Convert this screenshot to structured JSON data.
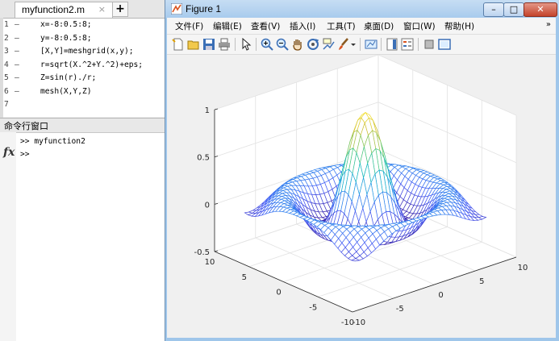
{
  "editor": {
    "tab_label": "myfunction2.m",
    "tab_close": "×",
    "new_tab": "+",
    "lines": [
      {
        "num": "1",
        "marker": "–",
        "code": "x=-8:0.5:8;"
      },
      {
        "num": "2",
        "marker": "–",
        "code": "y=-8:0.5:8;"
      },
      {
        "num": "3",
        "marker": "–",
        "code": "[X,Y]=meshgrid(x,y);"
      },
      {
        "num": "4",
        "marker": "–",
        "code": "r=sqrt(X.^2+Y.^2)+eps;"
      },
      {
        "num": "5",
        "marker": "–",
        "code": "Z=sin(r)./r;"
      },
      {
        "num": "6",
        "marker": "–",
        "code": "mesh(X,Y,Z)"
      },
      {
        "num": "7",
        "marker": "",
        "code": ""
      }
    ]
  },
  "command_window": {
    "title": "命令行窗口",
    "history": [
      ">> myfunction2",
      ">>"
    ],
    "fx": "fx"
  },
  "figure": {
    "title": "Figure 1",
    "menus": [
      "文件(F)",
      "编辑(E)",
      "查看(V)",
      "插入(I)",
      "工具(T)",
      "桌面(D)",
      "窗口(W)",
      "帮助(H)"
    ],
    "menu_overflow": "»",
    "window_buttons": {
      "minimize": "–",
      "maximize": "□",
      "close": "✕"
    },
    "toolbar_icons": [
      "new-figure-icon",
      "open-file-icon",
      "save-icon",
      "print-icon",
      "select-arrow-icon",
      "zoom-in-icon",
      "zoom-out-icon",
      "pan-hand-icon",
      "rotate-3d-icon",
      "data-cursor-icon",
      "brush-icon",
      "brush-dropdown-icon",
      "link-plot-icon",
      "colorbar-icon",
      "legend-icon",
      "hide-plot-tools-icon",
      "show-plot-tools-icon"
    ]
  },
  "chart_data": {
    "type": "mesh",
    "function": "Z = sin(r)./r, r = sqrt(X.^2+Y.^2)+eps",
    "x_range": [
      -8,
      8
    ],
    "y_range": [
      -8,
      8
    ],
    "step": 0.5,
    "zlim": [
      -0.5,
      1
    ],
    "x_ticks": [
      "-10",
      "-5",
      "0",
      "5",
      "10"
    ],
    "y_ticks": [
      "-10",
      "-5",
      "0",
      "5",
      "10"
    ],
    "z_ticks": [
      "-0.5",
      "0",
      "0.5",
      "1"
    ],
    "grid": true,
    "colormap": "parula"
  }
}
